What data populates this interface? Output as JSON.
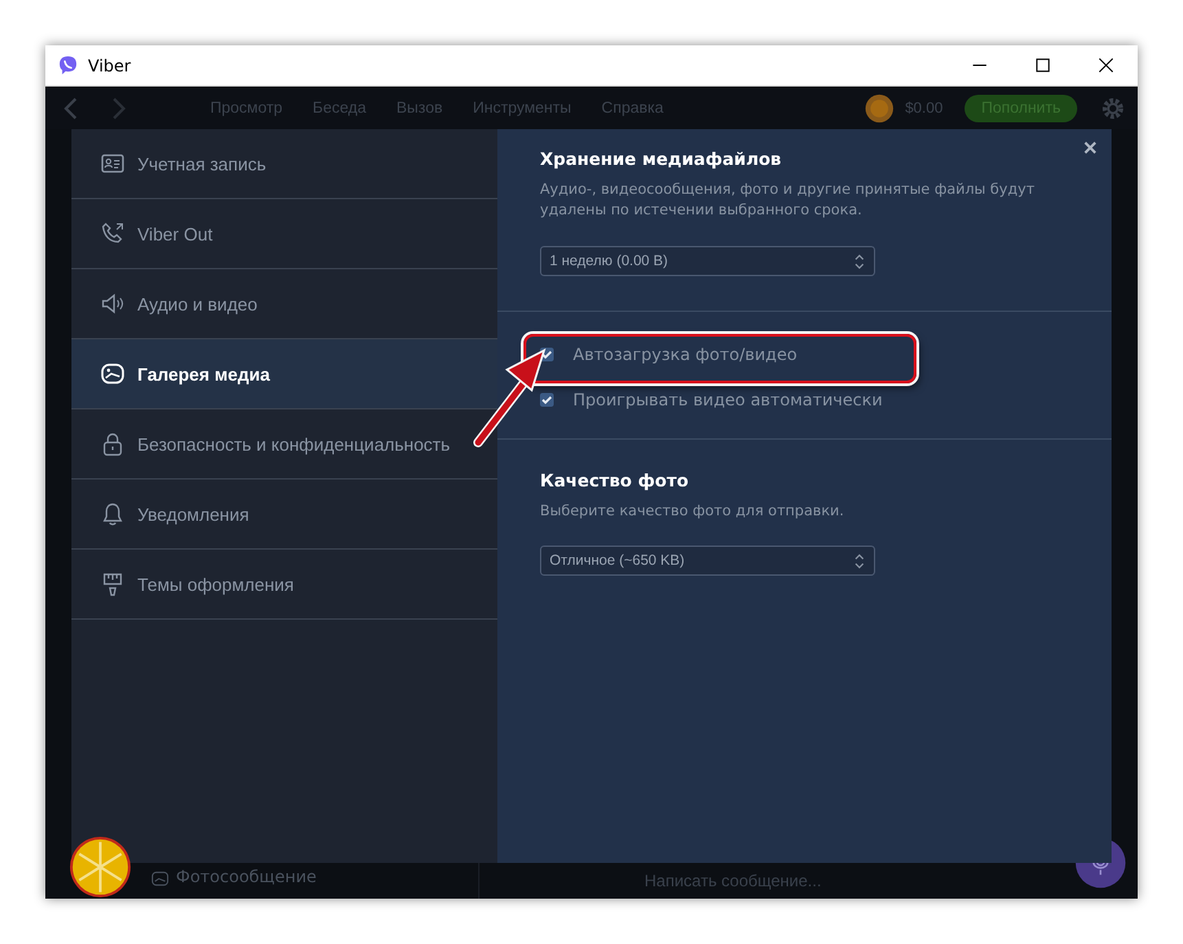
{
  "window": {
    "title": "Viber"
  },
  "toolbar": {
    "menu": [
      "Просмотр",
      "Беседа",
      "Вызов",
      "Инструменты",
      "Справка"
    ],
    "balance": "$0.00",
    "top_up": "Пополнить"
  },
  "settings": {
    "sidebar": {
      "items": [
        {
          "kind": "account",
          "label": "Учетная запись",
          "selected": false
        },
        {
          "kind": "phone",
          "label": "Viber Out",
          "selected": false
        },
        {
          "kind": "speaker",
          "label": "Аудио и видео",
          "selected": false
        },
        {
          "kind": "gallery",
          "label": "Галерея медиа",
          "selected": true
        },
        {
          "kind": "lock",
          "label": "Безопасность и конфиденциальность",
          "selected": false
        },
        {
          "kind": "bell",
          "label": "Уведомления",
          "selected": false
        },
        {
          "kind": "brush",
          "label": "Темы оформления",
          "selected": false
        }
      ]
    },
    "storage": {
      "title": "Хранение медиафайлов",
      "description": "Аудио-, видеосообщения, фото и другие принятые файлы будут удалены по истечении выбранного срока.",
      "value": "1 неделю (0.00 B)"
    },
    "checkboxes": [
      {
        "label": "Автозагрузка фото/видео",
        "checked": true,
        "highlighted": true
      },
      {
        "label": "Проигрывать видео автоматически",
        "checked": true,
        "highlighted": false
      }
    ],
    "quality": {
      "title": "Качество фото",
      "description": "Выберите качество фото для отправки.",
      "value": "Отличное (~650 KB)"
    }
  },
  "chat": {
    "last_message": "Фотосообщение",
    "composer_placeholder": "Написать сообщение..."
  }
}
